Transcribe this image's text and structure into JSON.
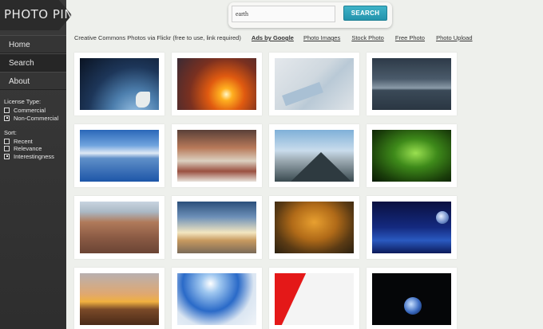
{
  "logo": "PHOTO PIN",
  "nav": [
    "Home",
    "Search",
    "About"
  ],
  "filters": {
    "license_title": "License Type:",
    "license_options": [
      {
        "label": "Commercial",
        "checked": false
      },
      {
        "label": "Non-Commercial",
        "checked": true
      }
    ],
    "sort_title": "Sort:",
    "sort_options": [
      {
        "label": "Recent",
        "checked": false
      },
      {
        "label": "Relevance",
        "checked": false
      },
      {
        "label": "Interestingness",
        "checked": true
      }
    ]
  },
  "search": {
    "value": "earth",
    "button": "SEARCH"
  },
  "links": {
    "description": "Creative Commons Photos via Flickr (free to use, link required)",
    "ads": "Ads by Google",
    "items": [
      "Photo Images",
      "Stock Photo",
      "Free Photo",
      "Photo Upload"
    ]
  },
  "photos": [
    {
      "name": "earth-orbit-photo"
    },
    {
      "name": "sunset-clouds-photo"
    },
    {
      "name": "satellite-map-photo"
    },
    {
      "name": "stormy-sea-photo"
    },
    {
      "name": "snow-mountains-lake-photo"
    },
    {
      "name": "christmas-village-photo"
    },
    {
      "name": "volcano-clouds-photo"
    },
    {
      "name": "green-dewdrop-photo"
    },
    {
      "name": "grand-canyon-photo"
    },
    {
      "name": "beach-sunset-photo"
    },
    {
      "name": "autumn-tree-photo"
    },
    {
      "name": "earth-moon-space-photo"
    },
    {
      "name": "field-sunset-photo"
    },
    {
      "name": "snowy-mountain-sun-photo"
    },
    {
      "name": "red-white-abstract-photo"
    },
    {
      "name": "earth-dark-space-photo"
    }
  ]
}
